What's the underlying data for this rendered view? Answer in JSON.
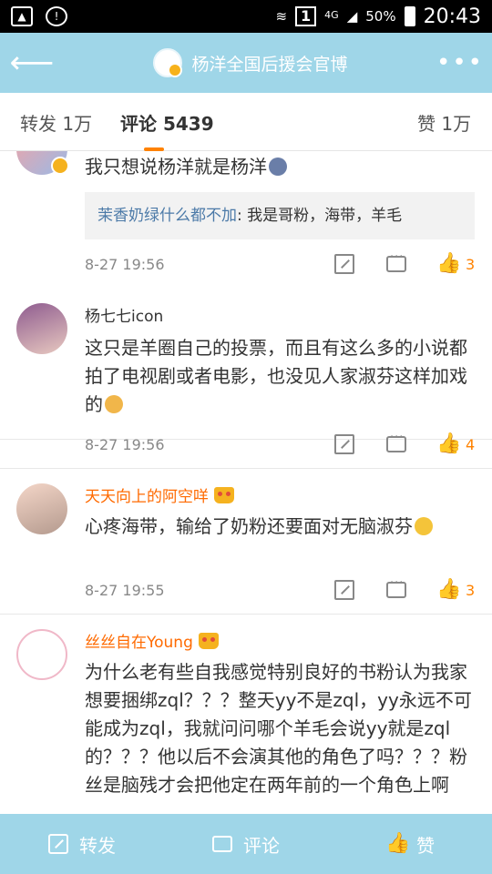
{
  "status_bar": {
    "network_type": "4G",
    "sim_slot": "1",
    "battery": "50%",
    "time": "20:43"
  },
  "header": {
    "back_icon": "arrow-left-icon",
    "title": "杨洋全国后援会官博",
    "more_icon": "more-dots-icon"
  },
  "tabs": [
    {
      "label": "转发 1万"
    },
    {
      "label": "评论 5439",
      "active": true
    },
    {
      "label": "赞 1万"
    }
  ],
  "comments": [
    {
      "name": "",
      "text": "我只想说杨洋就是杨洋",
      "quote_name": "茉香奶绿什么都不加",
      "quote_text": ": 我是哥粉，海带，羊毛",
      "date": "8-27 19:56",
      "likes": "3"
    },
    {
      "name": "杨七七icon",
      "text": "这只是羊圈自己的投票，而且有这么多的小说都拍了电视剧或者电影，也没见人家淑芬这样加戏的",
      "date": "8-27 19:56",
      "likes": "4"
    },
    {
      "name": "天天向上的阿空咩",
      "text": "心疼海带，输给了奶粉还要面对无脑淑芬",
      "date": "8-27 19:55",
      "likes": "3"
    },
    {
      "name": "丝丝自在Young",
      "text": "为什么老有些自我感觉特别良好的书粉认为我家想要捆绑zql？？？整天yy不是zql，yy永远不可能成为zql，我就问问哪个羊毛会说yy就是zql的？？？他以后不会演其他的角色了吗？？？粉丝是脑残才会把他定在两年前的一个角色上啊",
      "date": "",
      "likes": ""
    }
  ],
  "toolbar": {
    "repost_label": "转发",
    "comment_label": "评论",
    "like_label": "赞"
  },
  "colors": {
    "header_bg": "#9fd6e8",
    "accent": "#ff8200",
    "vip_name": "#ff6a00",
    "link": "#4c7aa8"
  }
}
